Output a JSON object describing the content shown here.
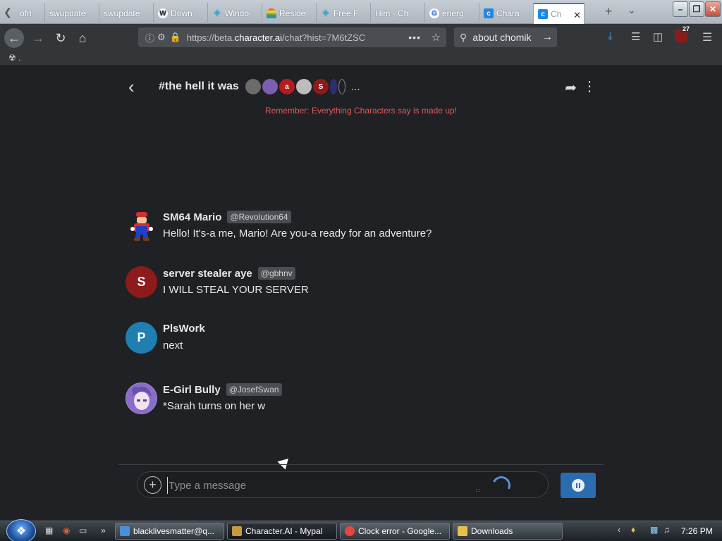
{
  "browser": {
    "tabs": [
      {
        "label": "ofri",
        "icon": "document-icon"
      },
      {
        "label": "swupdate",
        "icon": "document-icon"
      },
      {
        "label": "swupdate",
        "icon": "document-icon"
      },
      {
        "label": "Down",
        "icon": "wordpress-icon"
      },
      {
        "label": "Windo",
        "icon": "butterfly-icon"
      },
      {
        "label": "Reside",
        "icon": "rainbow-icon"
      },
      {
        "label": "Free F",
        "icon": "butterfly-icon"
      },
      {
        "label": "Him - Ch",
        "icon": "none"
      },
      {
        "label": "energ",
        "icon": "google-icon"
      },
      {
        "label": "Chara",
        "icon": "character-ai-icon"
      },
      {
        "label": "Ch",
        "icon": "character-ai-icon",
        "active": true
      }
    ],
    "url_prefix": "https://beta.",
    "url_host": "character.ai",
    "url_path": "/chat?hist=7M6tZSC",
    "search_query": "about chomik",
    "ublock_count": "27",
    "bookmark_text": "."
  },
  "chat": {
    "title": "#the hell it was",
    "participant_avatars": [
      {
        "label": "",
        "color": "#6b6b6b"
      },
      {
        "label": "",
        "color": "#7a5fb0"
      },
      {
        "label": "a",
        "color": "#b71c1c"
      },
      {
        "label": "",
        "color": "#bdbdbd"
      },
      {
        "label": "S",
        "color": "#8e1b1b"
      },
      {
        "label": "",
        "color": "#2d2f6e"
      },
      {
        "label": "",
        "color": "#202124"
      }
    ],
    "more_label": "...",
    "disclaimer": "Remember: Everything Characters say is made up!",
    "messages": [
      {
        "name": "SM64 Mario",
        "handle": "@Revolution64",
        "text": "Hello! It's-a me, Mario! Are you-a ready for an adventure?",
        "avatar_letter": "",
        "avatar_color": "#c62828"
      },
      {
        "name": "server stealer aye",
        "handle": "@gbhnv",
        "text": "I WILL STEAL YOUR SERVER",
        "avatar_letter": "S",
        "avatar_color": "#8e1b1b"
      },
      {
        "name": "PlsWork",
        "handle": "",
        "text": "next",
        "avatar_letter": "P",
        "avatar_color": "#1f7fb0"
      },
      {
        "name": "E-Girl Bully",
        "handle": "@JosefSwan",
        "text": "*Sarah turns on her w",
        "avatar_letter": "",
        "avatar_color": "#8a6cc9"
      }
    ],
    "composer": {
      "placeholder": "Type a message"
    }
  },
  "taskbar": {
    "tasks": [
      {
        "label": "blacklivesmatter@q...",
        "icon_color": "#4a90d9"
      },
      {
        "label": "Character.AI - Mypal",
        "icon_color": "#c99a3a",
        "active": true
      },
      {
        "label": "Clock error - Google...",
        "icon_color": "#e8453c"
      },
      {
        "label": "Downloads",
        "icon_color": "#e8c14a"
      }
    ],
    "clock": "7:26 PM"
  }
}
